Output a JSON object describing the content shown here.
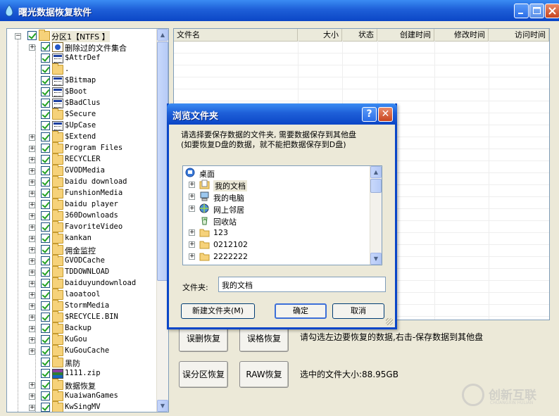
{
  "window": {
    "title": "曙光数据恢复软件"
  },
  "tree": {
    "root": {
      "label": "分区1【NTFS 】"
    },
    "items": [
      {
        "label": "删除过的文件集合",
        "icon": "deleted-files-icon",
        "expander": true
      },
      {
        "label": "$AttrDef",
        "icon": "system-file-icon",
        "expander": false
      },
      {
        "label": ".",
        "icon": "folder-icon",
        "expander": false
      },
      {
        "label": "$Bitmap",
        "icon": "system-file-icon",
        "expander": false
      },
      {
        "label": "$Boot",
        "icon": "system-file-icon",
        "expander": false
      },
      {
        "label": "$BadClus",
        "icon": "system-file-icon",
        "expander": false
      },
      {
        "label": "$Secure",
        "icon": "folder-icon",
        "expander": false
      },
      {
        "label": "$UpCase",
        "icon": "system-file-icon",
        "expander": false
      },
      {
        "label": "$Extend",
        "icon": "folder-icon",
        "expander": true
      },
      {
        "label": "Program Files",
        "icon": "folder-icon",
        "expander": true
      },
      {
        "label": "RECYCLER",
        "icon": "folder-icon",
        "expander": true
      },
      {
        "label": "GVODMedia",
        "icon": "folder-icon",
        "expander": true
      },
      {
        "label": "baidu download",
        "icon": "folder-icon",
        "expander": true
      },
      {
        "label": "FunshionMedia",
        "icon": "folder-icon",
        "expander": true
      },
      {
        "label": "baidu player",
        "icon": "folder-icon",
        "expander": true
      },
      {
        "label": "360Downloads",
        "icon": "folder-icon",
        "expander": true
      },
      {
        "label": "FavoriteVideo",
        "icon": "folder-icon",
        "expander": true
      },
      {
        "label": "kankan",
        "icon": "folder-icon",
        "expander": true
      },
      {
        "label": "佣金监控",
        "icon": "folder-icon",
        "expander": true
      },
      {
        "label": "GVODCache",
        "icon": "folder-icon",
        "expander": true
      },
      {
        "label": "TDDOWNLOAD",
        "icon": "folder-icon",
        "expander": true
      },
      {
        "label": "baiduyundownload",
        "icon": "folder-icon",
        "expander": true
      },
      {
        "label": "laoatool",
        "icon": "folder-icon",
        "expander": true
      },
      {
        "label": "StormMedia",
        "icon": "folder-icon",
        "expander": true
      },
      {
        "label": "$RECYCLE.BIN",
        "icon": "folder-icon",
        "expander": true
      },
      {
        "label": "Backup",
        "icon": "folder-icon",
        "expander": true
      },
      {
        "label": "KuGou",
        "icon": "folder-icon",
        "expander": true
      },
      {
        "label": "KuGouCache",
        "icon": "folder-icon",
        "expander": true
      },
      {
        "label": "黑防",
        "icon": "folder-icon",
        "expander": false
      },
      {
        "label": "1111.zip",
        "icon": "zip-file-icon",
        "expander": false
      },
      {
        "label": "数据恢复",
        "icon": "folder-icon",
        "expander": true
      },
      {
        "label": "KuaiwanGames",
        "icon": "folder-icon",
        "expander": true
      },
      {
        "label": "KwSingMV",
        "icon": "folder-icon",
        "expander": true
      }
    ]
  },
  "list": {
    "columns": [
      "文件名",
      "大小",
      "状态",
      "创建时间",
      "修改时间",
      "访问时间"
    ]
  },
  "actions": {
    "mistake_delete": "误删恢复",
    "mistake_format": "误格恢复",
    "mistake_partition": "误分区恢复",
    "raw": "RAW恢复"
  },
  "info": {
    "hint": "请勾选左边要恢复的数据,右击-保存数据到其他盘",
    "selected_size": "选中的文件大小:88.95GB"
  },
  "dialog": {
    "title": "浏览文件夹",
    "help_glyph": "?",
    "close_glyph": "✕",
    "desc_line1": "请选择要保存数据的文件夹, 需要数据保存到其他盘",
    "desc_line2": "(如要恢复D盘的数据，就不能把数据保存到D盘)",
    "tree": [
      {
        "label": "桌面",
        "icon": "desktop-icon"
      },
      {
        "label": "我的文档",
        "icon": "my-documents-icon",
        "selected": true
      },
      {
        "label": "我的电脑",
        "icon": "my-computer-icon"
      },
      {
        "label": "网上邻居",
        "icon": "network-places-icon"
      },
      {
        "label": "回收站",
        "icon": "recycle-bin-icon"
      },
      {
        "label": "123",
        "icon": "folder-icon"
      },
      {
        "label": "0212102",
        "icon": "folder-icon"
      },
      {
        "label": "2222222",
        "icon": "folder-icon"
      }
    ],
    "folder_label": "文件夹:",
    "folder_value": "我的文档",
    "new_folder": "新建文件夹(M)",
    "ok": "确定",
    "cancel": "取消"
  },
  "watermark": {
    "text": "创新互联",
    "sub": "CHUANGXIN HULIAN"
  }
}
